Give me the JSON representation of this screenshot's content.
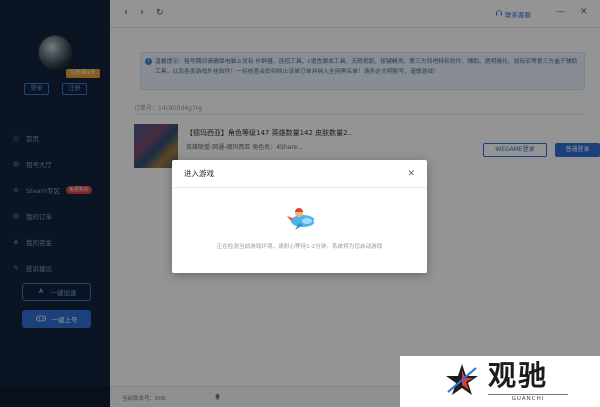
{
  "sidebar": {
    "vip_badge": "注册满4天",
    "login_label": "登录",
    "register_label": "注册",
    "nav": [
      {
        "label": "首页",
        "icon": "home-icon",
        "glyph": "◎"
      },
      {
        "label": "租号大厅",
        "icon": "hall-icon",
        "glyph": "◍"
      },
      {
        "label": "Steam专区",
        "icon": "steam-icon",
        "glyph": "⊛",
        "badge": "免费购买"
      },
      {
        "label": "我的订单",
        "icon": "order-icon",
        "glyph": "▤"
      },
      {
        "label": "我的资金",
        "icon": "wallet-icon",
        "glyph": "◈"
      },
      {
        "label": "投诉建议",
        "icon": "feedback-icon",
        "glyph": "✎"
      }
    ],
    "quick_accelerate": "一键加速",
    "quick_login": "一键上号"
  },
  "topbar": {
    "back_glyph": "‹",
    "forward_glyph": "›",
    "refresh_glyph": "↻",
    "service_label": "联系客服",
    "minimize_glyph": "—",
    "close_glyph": "✕"
  },
  "notice": {
    "text": "温馨提示：租号期间请确保电脑上没有 补群器、连招工具、c语言脚本工具、无限视距、按键精灵、第三方同吧特权软件、辅助、透明掩化、鼠标宏等第三方盒子辅助工具，以及各类游戏外挂软件！一经核查会即刻终止该单订单并纳入全网黑名单！请务必文明租号，谨慎游戏！"
  },
  "order": {
    "label": "订单号：14c800d4g7rg"
  },
  "account": {
    "title": "【德玛西亚】角色等级147 英雄数量142 皮肤数量2..",
    "sub": "英雄联盟-网通-德玛西亚  角色名：4Share...",
    "wegame_label": "WEGAME登录",
    "normal_label": "普通登录"
  },
  "status_bar": {
    "version": "当前版本号：506"
  },
  "modal": {
    "title": "进入游戏",
    "close_glyph": "✕",
    "message": "正在检测当前游戏环境，请耐心等待1-2分钟，系统将为您启动游戏"
  },
  "watermark": {
    "text": "观驰",
    "sub": "GUANCHI"
  },
  "colors": {
    "accent": "#2f6fd6",
    "sidebar_bg": "#13243b",
    "vip": "#e7a13a",
    "badge_red": "#d64545",
    "notice_bg": "#eaf3fd"
  }
}
